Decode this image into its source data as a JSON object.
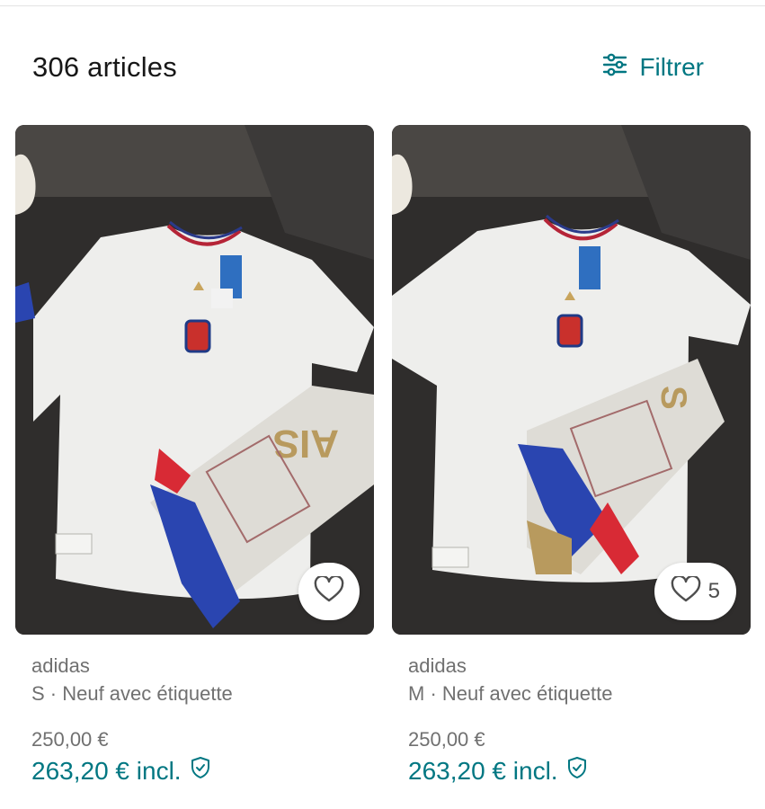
{
  "header": {
    "count_label": "306 articles",
    "filter_label": "Filtrer",
    "filter_icon": "sliders-icon"
  },
  "accent_color": "#007782",
  "items": [
    {
      "brand": "adidas",
      "details": "S · Neuf avec étiquette",
      "price": "250,00 €",
      "price_incl": "263,20 € incl.",
      "favourites": ""
    },
    {
      "brand": "adidas",
      "details": "M · Neuf avec étiquette",
      "price": "250,00 €",
      "price_incl": "263,20 € incl.",
      "favourites": "5"
    }
  ]
}
